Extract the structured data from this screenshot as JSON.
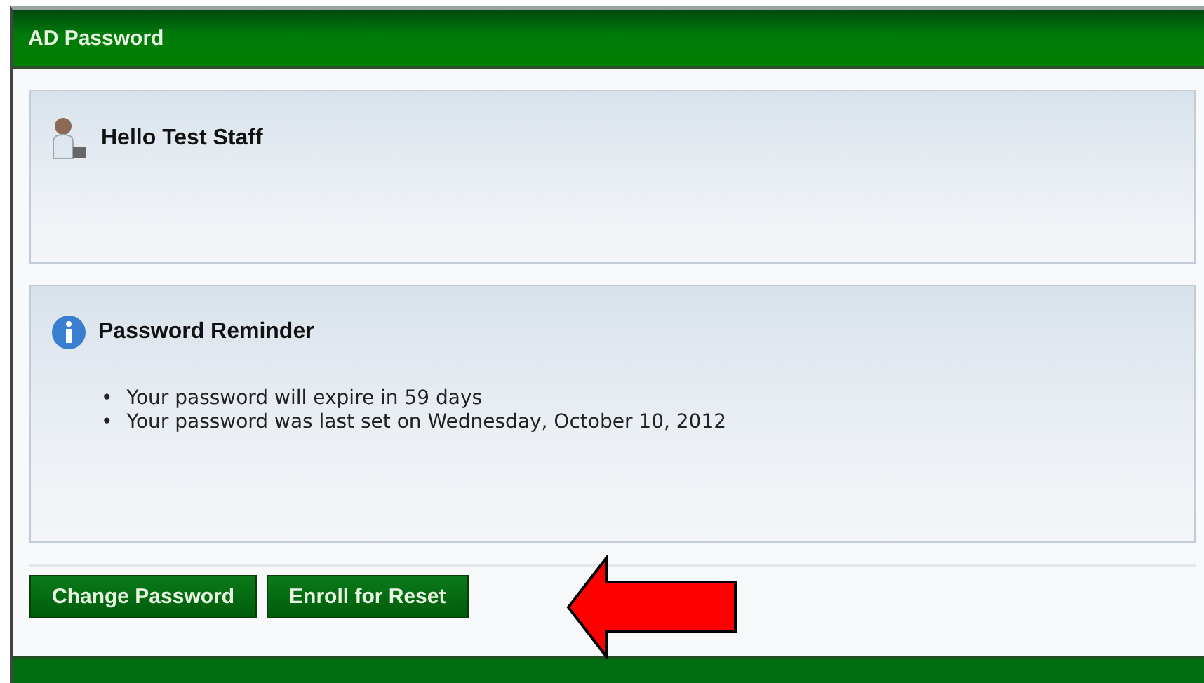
{
  "window": {
    "title": "AD Password"
  },
  "greeting": {
    "text": "Hello Test Staff"
  },
  "reminder": {
    "title": "Password Reminder",
    "items": [
      {
        "bullet": "•",
        "text": "Your password will expire in 59 days"
      },
      {
        "bullet": "•",
        "text": "Your password was last set on Wednesday, October 10, 2012"
      }
    ]
  },
  "buttons": [
    "Change Password",
    "Enroll for Reset"
  ]
}
